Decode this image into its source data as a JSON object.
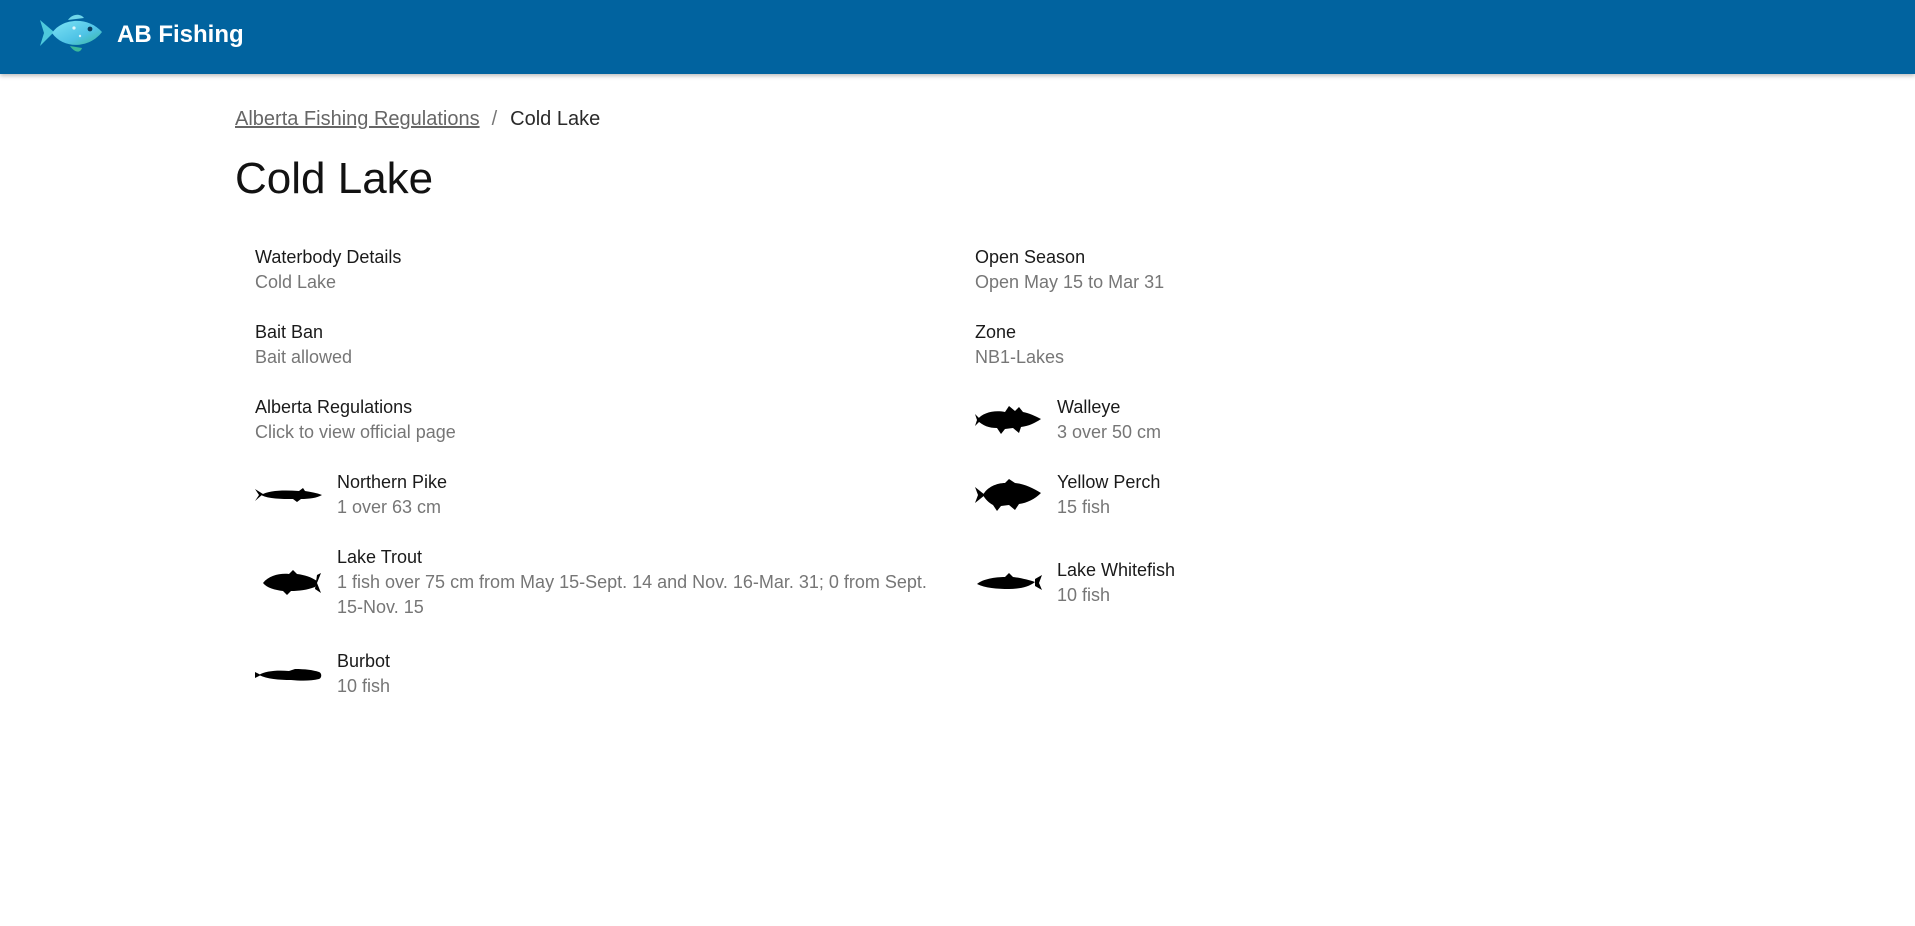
{
  "app": {
    "title": "AB Fishing",
    "logo_icon": "fish-logo-icon",
    "bar_color": "#01639f"
  },
  "breadcrumb": {
    "parent": "Alberta Fishing Regulations",
    "separator": "/",
    "current": "Cold Lake"
  },
  "page": {
    "title": "Cold Lake"
  },
  "details": {
    "waterbody": {
      "label": "Waterbody Details",
      "value": "Cold Lake"
    },
    "open_season": {
      "label": "Open Season",
      "value": "Open May 15 to Mar 31"
    },
    "bait_ban": {
      "label": "Bait Ban",
      "value": "Bait allowed"
    },
    "zone": {
      "label": "Zone",
      "value": "NB1-Lakes"
    },
    "regulations": {
      "label": "Alberta Regulations",
      "value": "Click to view official page"
    }
  },
  "species": {
    "walleye": {
      "name": "Walleye",
      "limit": "3 over 50 cm",
      "icon": "walleye-icon"
    },
    "northern_pike": {
      "name": "Northern Pike",
      "limit": "1 over 63 cm",
      "icon": "northern-pike-icon"
    },
    "yellow_perch": {
      "name": "Yellow Perch",
      "limit": "15 fish",
      "icon": "yellow-perch-icon"
    },
    "lake_trout": {
      "name": "Lake Trout",
      "limit_line1": "1 fish over 75 cm from May 15-Sept. 14 and Nov. 16-Mar. 31; 0 from Sept.",
      "limit_line2": "15-Nov. 15",
      "icon": "lake-trout-icon"
    },
    "lake_whitefish": {
      "name": "Lake Whitefish",
      "limit": "10 fish",
      "icon": "lake-whitefish-icon"
    },
    "burbot": {
      "name": "Burbot",
      "limit": "10 fish",
      "icon": "burbot-icon"
    }
  }
}
